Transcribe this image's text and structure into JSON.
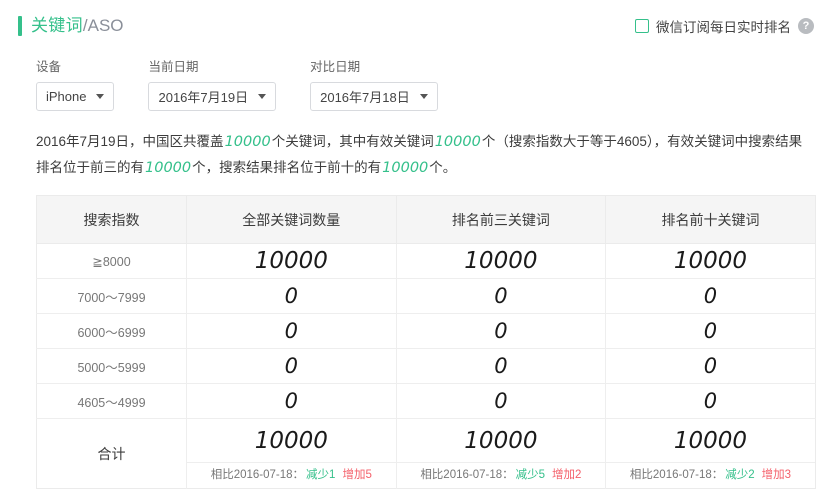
{
  "header": {
    "title_main": "关键词",
    "title_sub": "/ASO",
    "subscribe_label": "微信订阅每日实时排名",
    "help_icon": "question-mark-icon",
    "checkbox_checked": false,
    "accent_color": "#35c08b"
  },
  "filters": [
    {
      "label": "设备",
      "value": "iPhone"
    },
    {
      "label": "当前日期",
      "value": "2016年7月19日"
    },
    {
      "label": "对比日期",
      "value": "2016年7月18日"
    }
  ],
  "summary": {
    "p1": "2016年7月19日，中国区共覆盖",
    "n1": "10000",
    "p2": "个关键词，其中有效关键词",
    "n2": "10000",
    "p3": "个（搜索指数大于等于4605），有效关键词中搜索结果",
    "p4": "排名位于前三的有",
    "n3": "10000",
    "p5": "个，搜索结果排名位于前十的有",
    "n4": "10000",
    "p6": "个。"
  },
  "table": {
    "columns": [
      "搜索指数",
      "全部关键词数量",
      "排名前三关键词",
      "排名前十关键词"
    ],
    "rows": [
      {
        "index": "≧8000",
        "all": "10000",
        "top3": "10000",
        "top10": "10000"
      },
      {
        "index": "7000～7999",
        "all": "0",
        "top3": "0",
        "top10": "0"
      },
      {
        "index": "6000～6999",
        "all": "0",
        "top3": "0",
        "top10": "0"
      },
      {
        "index": "5000～5999",
        "all": "0",
        "top3": "0",
        "top10": "0"
      },
      {
        "index": "4605～4999",
        "all": "0",
        "top3": "0",
        "top10": "0"
      }
    ],
    "total": {
      "label": "合计",
      "all": {
        "value": "10000",
        "compare_prefix": "相比2016-07-18：",
        "decrease": "减少1",
        "increase": "增加5"
      },
      "top3": {
        "value": "10000",
        "compare_prefix": "相比2016-07-18：",
        "decrease": "减少5",
        "increase": "增加2"
      },
      "top10": {
        "value": "10000",
        "compare_prefix": "相比2016-07-18：",
        "decrease": "减少2",
        "increase": "增加3"
      }
    },
    "decrease_color": "#35c08b",
    "increase_color": "#f4616b"
  }
}
